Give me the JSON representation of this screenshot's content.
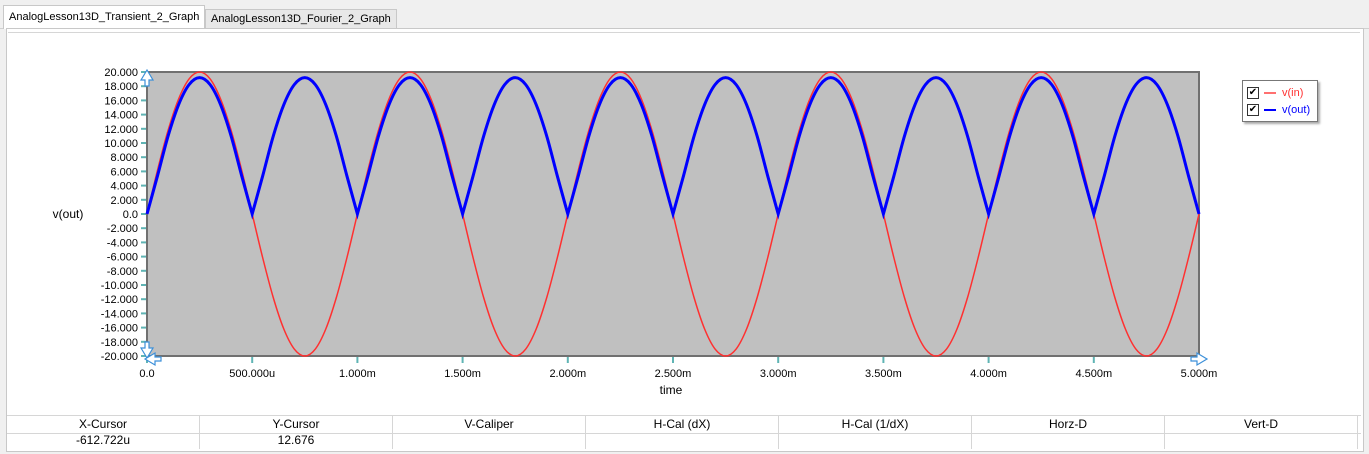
{
  "tabs": [
    {
      "label": "AnalogLesson13D_Transient_2_Graph",
      "active": true
    },
    {
      "label": "AnalogLesson13D_Fourier_2_Graph",
      "active": false
    }
  ],
  "legend": [
    {
      "label": "v(in)",
      "checked": true,
      "color": "#ff3030"
    },
    {
      "label": "v(out)",
      "checked": true,
      "color": "#0000ff"
    }
  ],
  "cursor_table": {
    "headers": [
      "X-Cursor",
      "Y-Cursor",
      "V-Caliper",
      "H-Cal (dX)",
      "H-Cal (1/dX)",
      "Horz-D",
      "Vert-D"
    ],
    "values": [
      "-612.722u",
      "12.676",
      "",
      "",
      "",
      "",
      ""
    ]
  },
  "colors": {
    "plot_background": "#c0c0c0",
    "vin": "#ff3030",
    "vout": "#0000ff"
  },
  "chart_data": {
    "type": "line",
    "title": "",
    "xlabel": "time",
    "ylabel": "v(out)",
    "xlim": [
      0,
      0.005
    ],
    "ylim": [
      -20,
      20
    ],
    "grid": false,
    "legend_position": "right",
    "xticks": [
      "0.0",
      "500.000u",
      "1.000m",
      "1.500m",
      "2.000m",
      "2.500m",
      "3.000m",
      "3.500m",
      "4.000m",
      "4.500m",
      "5.000m"
    ],
    "yticks": [
      "20.000",
      "18.000",
      "16.000",
      "14.000",
      "12.000",
      "10.000",
      "8.000",
      "6.000",
      "4.000",
      "2.000",
      "0.0",
      "-2.000",
      "-4.000",
      "-6.000",
      "-8.000",
      "-10.000",
      "-12.000",
      "-14.000",
      "-16.000",
      "-18.000",
      "-20.000"
    ],
    "x": [
      0,
      5e-05,
      0.0001,
      0.00015,
      0.0002,
      0.00025,
      0.0003,
      0.00035,
      0.0004,
      0.00045,
      0.0005,
      0.00055,
      0.0006,
      0.00065,
      0.0007,
      0.00075,
      0.0008,
      0.00085,
      0.0009,
      0.00095,
      0.001,
      0.00105,
      0.0011,
      0.00115,
      0.0012,
      0.00125,
      0.0013,
      0.00135,
      0.0014,
      0.00145,
      0.0015,
      0.00155,
      0.0016,
      0.00165,
      0.0017,
      0.00175,
      0.0018,
      0.00185,
      0.0019,
      0.00195,
      0.002,
      0.00205,
      0.0021,
      0.00215,
      0.0022,
      0.00225,
      0.0023,
      0.00235,
      0.0024,
      0.00245,
      0.0025,
      0.00255,
      0.0026,
      0.00265,
      0.0027,
      0.00275,
      0.0028,
      0.00285,
      0.0029,
      0.00295,
      0.003,
      0.00305,
      0.0031,
      0.00315,
      0.0032,
      0.00325,
      0.0033,
      0.00335,
      0.0034,
      0.00345,
      0.0035,
      0.00355,
      0.0036,
      0.00365,
      0.0037,
      0.00375,
      0.0038,
      0.00385,
      0.0039,
      0.00395,
      0.004,
      0.00405,
      0.0041,
      0.00415,
      0.0042,
      0.00425,
      0.0043,
      0.00435,
      0.0044,
      0.00445,
      0.0045,
      0.00455,
      0.0046,
      0.00465,
      0.0047,
      0.00475,
      0.0048,
      0.00485,
      0.0049,
      0.00495,
      0.005
    ],
    "series": [
      {
        "name": "v(in)",
        "values": [
          0,
          6.18,
          11.76,
          16.18,
          19.02,
          20,
          19.02,
          16.18,
          11.76,
          6.18,
          0,
          -6.18,
          -11.76,
          -16.18,
          -19.02,
          -20,
          -19.02,
          -16.18,
          -11.76,
          -6.18,
          0,
          6.18,
          11.76,
          16.18,
          19.02,
          20,
          19.02,
          16.18,
          11.76,
          6.18,
          0,
          -6.18,
          -11.76,
          -16.18,
          -19.02,
          -20,
          -19.02,
          -16.18,
          -11.76,
          -6.18,
          0,
          6.18,
          11.76,
          16.18,
          19.02,
          20,
          19.02,
          16.18,
          11.76,
          6.18,
          0,
          -6.18,
          -11.76,
          -16.18,
          -19.02,
          -20,
          -19.02,
          -16.18,
          -11.76,
          -6.18,
          0,
          6.18,
          11.76,
          16.18,
          19.02,
          20,
          19.02,
          16.18,
          11.76,
          6.18,
          0,
          -6.18,
          -11.76,
          -16.18,
          -19.02,
          -20,
          -19.02,
          -16.18,
          -11.76,
          -6.18,
          0,
          6.18,
          11.76,
          16.18,
          19.02,
          20,
          19.02,
          16.18,
          11.76,
          6.18,
          0,
          -6.18,
          -11.76,
          -16.18,
          -19.02,
          -20,
          -19.02,
          -16.18,
          -11.76,
          -6.18,
          0
        ]
      },
      {
        "name": "v(out)",
        "values": [
          0,
          5.38,
          10.96,
          15.38,
          18.22,
          19.2,
          18.22,
          15.38,
          10.96,
          5.38,
          0,
          5.38,
          10.96,
          15.38,
          18.22,
          19.2,
          18.22,
          15.38,
          10.96,
          5.38,
          0,
          5.38,
          10.96,
          15.38,
          18.22,
          19.2,
          18.22,
          15.38,
          10.96,
          5.38,
          0,
          5.38,
          10.96,
          15.38,
          18.22,
          19.2,
          18.22,
          15.38,
          10.96,
          5.38,
          0,
          5.38,
          10.96,
          15.38,
          18.22,
          19.2,
          18.22,
          15.38,
          10.96,
          5.38,
          0,
          5.38,
          10.96,
          15.38,
          18.22,
          19.2,
          18.22,
          15.38,
          10.96,
          5.38,
          0,
          5.38,
          10.96,
          15.38,
          18.22,
          19.2,
          18.22,
          15.38,
          10.96,
          5.38,
          0,
          5.38,
          10.96,
          15.38,
          18.22,
          19.2,
          18.22,
          15.38,
          10.96,
          5.38,
          0,
          5.38,
          10.96,
          15.38,
          18.22,
          19.2,
          18.22,
          15.38,
          10.96,
          5.38,
          0,
          5.38,
          10.96,
          15.38,
          18.22,
          19.2,
          18.22,
          15.38,
          10.96,
          5.38,
          0
        ]
      }
    ]
  }
}
